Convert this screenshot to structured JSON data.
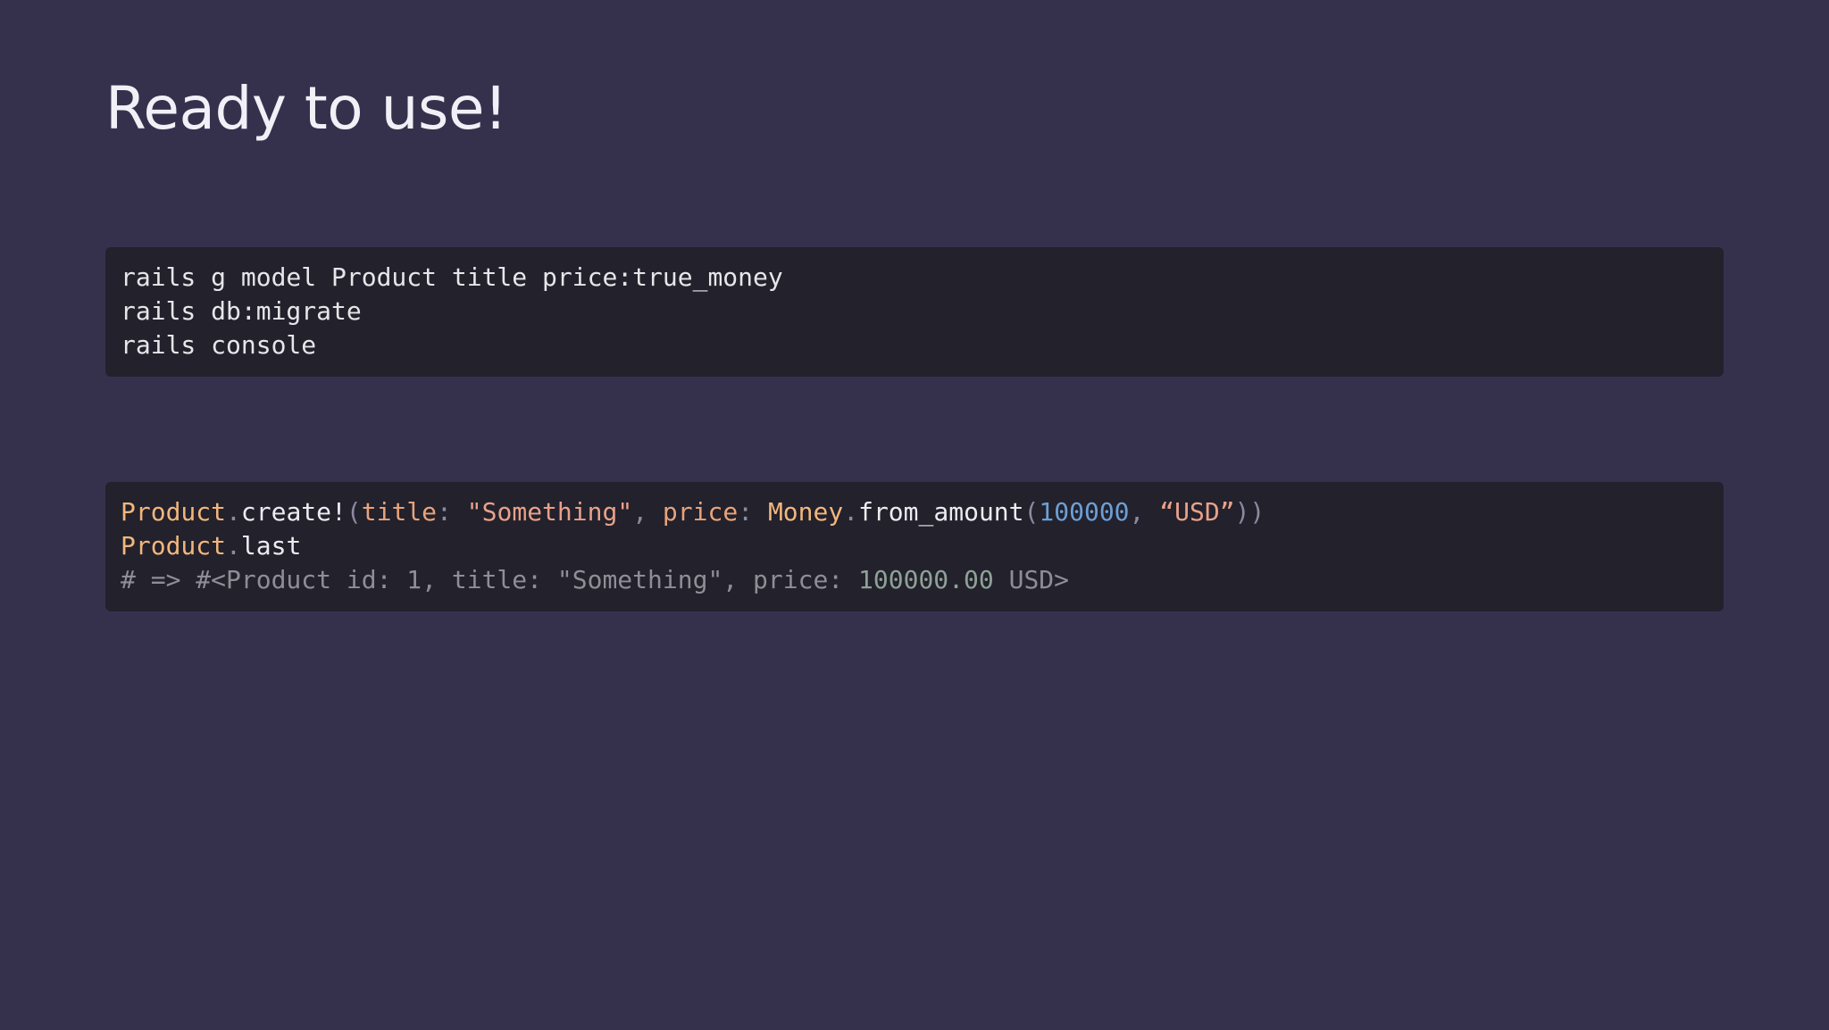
{
  "slide": {
    "title": "Ready to use!"
  },
  "shell_block": {
    "lines": [
      "rails g model Product title price:true_money",
      "rails db:migrate",
      "rails console"
    ]
  },
  "ruby_block": {
    "line1": {
      "const1": "Product",
      "dot1": ".",
      "method1": "create!",
      "paren_open": "(",
      "key1": "title",
      "colon1": ": ",
      "str1": "\"Something\"",
      "comma1": ", ",
      "key2": "price",
      "colon2": ": ",
      "const2": "Money",
      "dot2": ".",
      "method2": "from_amount",
      "paren_open2": "(",
      "number": "100000",
      "comma2": ", ",
      "str2": "“USD”",
      "paren_close": "))"
    },
    "line2": {
      "const": "Product",
      "dot": ".",
      "method": "last"
    },
    "line3": {
      "comment_a": "# => #<Product id: 1, title: \"Something\", price: ",
      "comment_value": "100000.00",
      "comment_b": " USD>"
    }
  },
  "colors": {
    "background": "#35314d",
    "code_background": "#22212c",
    "constant": "#f2b67c",
    "string": "#e9a189",
    "number": "#6d9fd6",
    "comment": "#8f8e96"
  }
}
